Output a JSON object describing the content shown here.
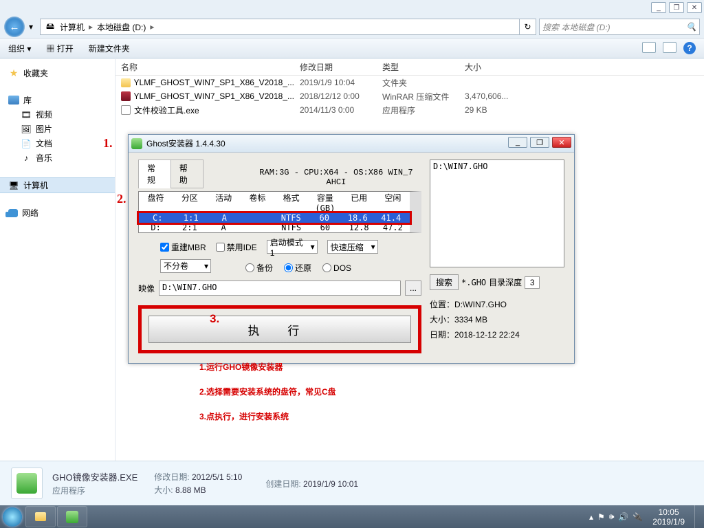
{
  "topctrl": {
    "min": "_",
    "max": "❐",
    "close": "✕"
  },
  "nav": {
    "back": "←",
    "hist": "▾"
  },
  "breadcrumb": {
    "sep": "▸",
    "computer": "计算机",
    "disk": "本地磁盘 (D:)"
  },
  "search": {
    "placeholder": "搜索 本地磁盘 (D:)"
  },
  "toolbar": {
    "organize": "组织 ▾",
    "open": "打开",
    "newfolder": "新建文件夹",
    "help": "?"
  },
  "sidebar": {
    "fav": "收藏夹",
    "lib": "库",
    "libs": [
      "视频",
      "图片",
      "文档",
      "音乐"
    ],
    "computer": "计算机",
    "network": "网络"
  },
  "columns": {
    "name": "名称",
    "date": "修改日期",
    "type": "类型",
    "size": "大小"
  },
  "files": [
    {
      "name": "YLMF_GHOST_WIN7_SP1_X86_V2018_...",
      "date": "2019/1/9 10:04",
      "type": "文件夹",
      "size": "",
      "icon": "fold"
    },
    {
      "name": "YLMF_GHOST_WIN7_SP1_X86_V2018_...",
      "date": "2018/12/12 0:00",
      "type": "WinRAR 压缩文件",
      "size": "3,470,606...",
      "icon": "rar"
    },
    {
      "name": "文件校验工具.exe",
      "date": "2014/11/3 0:00",
      "type": "应用程序",
      "size": "29 KB",
      "icon": "exe"
    }
  ],
  "dialog": {
    "title": "Ghost安装器 1.4.4.30",
    "tabs": {
      "general": "常规",
      "help": "帮助"
    },
    "sysinfo": "RAM:3G - CPU:X64 - OS:X86 WIN_7 AHCI",
    "headers": [
      "盘符",
      "分区",
      "活动",
      "卷标",
      "格式",
      "容量(GB)",
      "已用",
      "空闲"
    ],
    "rows": [
      {
        "cells": [
          "C:",
          "1:1",
          "A",
          "",
          "NTFS",
          "60",
          "18.6",
          "41.4"
        ],
        "sel": true
      },
      {
        "cells": [
          "D:",
          "2:1",
          "A",
          "",
          "NTFS",
          "60",
          "12.8",
          "47.2"
        ],
        "sel": false
      }
    ],
    "rebuildmbr": "重建MBR",
    "disableide": "禁用IDE",
    "bootmode": "启动模式1",
    "bootarrow": "▾",
    "compress": "快速压缩",
    "comparrow": "▾",
    "split": "不分卷",
    "splitarrow": "▾",
    "backup": "备份",
    "restore": "还原",
    "dos": "DOS",
    "imglabel": "映像",
    "imgpath": "D:\\WIN7.GHO",
    "dots": "...",
    "exec": "执 行",
    "rightpath": "D:\\WIN7.GHO",
    "searchbtn": "搜索",
    "ext": "*.GHO",
    "depthlabel": "目录深度",
    "depth": "3",
    "loc_l": "位置：",
    "loc_v": "D:\\WIN7.GHO",
    "size_l": "大小：",
    "size_v": "3334 MB",
    "date_l": "日期：",
    "date_v": "2018-12-12  22:24"
  },
  "ann": {
    "n1": "1.",
    "n2": "2.",
    "n3": "3.",
    "l1": "1.运行GHO镜像安装器",
    "l2": "2.选择需要安装系统的盘符，常见C盘",
    "l3": "3.点执行，进行安装系统"
  },
  "details": {
    "name": "GHO镜像安装器.EXE",
    "app": "应用程序",
    "mod_l": "修改日期:",
    "mod_v": "2012/5/1 5:10",
    "size_l": "大小:",
    "size_v": "8.88 MB",
    "crt_l": "创建日期:",
    "crt_v": "2019/1/9 10:01"
  },
  "tray": {
    "expand": "▴"
  },
  "clock": {
    "time": "10:05",
    "date": "2019/1/9"
  }
}
